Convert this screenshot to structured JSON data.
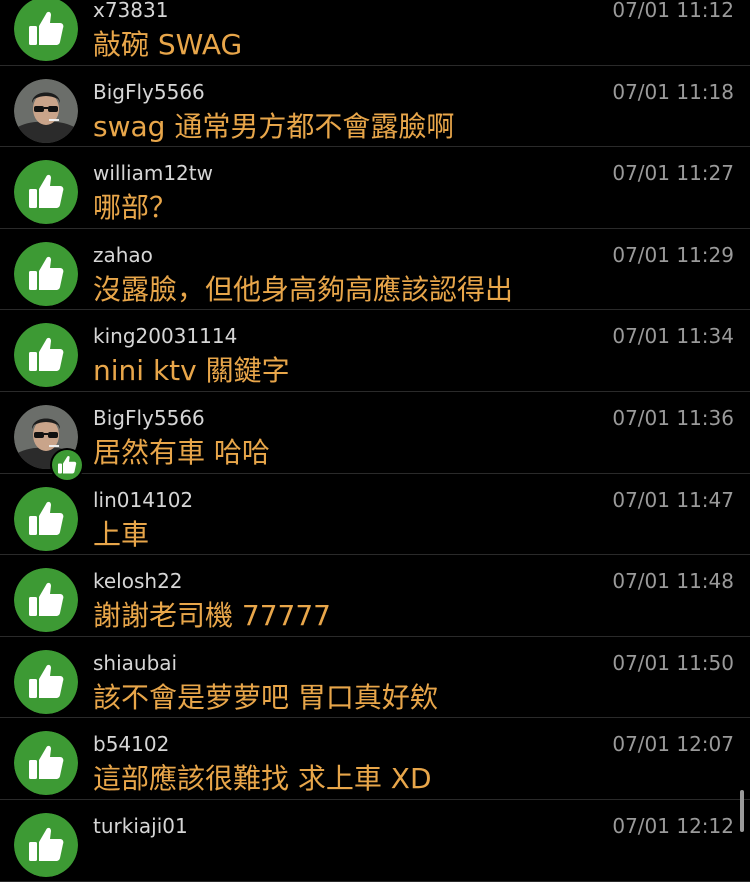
{
  "colors": {
    "background": "#000000",
    "username": "#d6d6d6",
    "timestamp": "#9a9a9a",
    "message": "#e8a64a",
    "like_avatar": "#3d9a34"
  },
  "comments": [
    {
      "username": "x73831",
      "time": "07/01 11:12",
      "text": "敲碗 SWAG",
      "avatar": "thumbs-up-icon"
    },
    {
      "username": "BigFly5566",
      "time": "07/01 11:18",
      "text": "swag 通常男方都不會露臉啊",
      "avatar": "user-photo"
    },
    {
      "username": "william12tw",
      "time": "07/01 11:27",
      "text": "哪部？",
      "avatar": "thumbs-up-icon"
    },
    {
      "username": "zahao",
      "time": "07/01 11:29",
      "text": "沒露臉，但他身高夠高應該認得出",
      "avatar": "thumbs-up-icon"
    },
    {
      "username": "king20031114",
      "time": "07/01 11:34",
      "text": "nini ktv 關鍵字",
      "avatar": "thumbs-up-icon"
    },
    {
      "username": "BigFly5566",
      "time": "07/01 11:36",
      "text": "居然有車 哈哈",
      "avatar": "user-photo-liked"
    },
    {
      "username": "lin014102",
      "time": "07/01 11:47",
      "text": "上車",
      "avatar": "thumbs-up-icon"
    },
    {
      "username": "kelosh22",
      "time": "07/01 11:48",
      "text": "謝謝老司機 77777",
      "avatar": "thumbs-up-icon"
    },
    {
      "username": "shiaubai",
      "time": "07/01 11:50",
      "text": "該不會是萝萝吧 胃口真好欸",
      "avatar": "thumbs-up-icon"
    },
    {
      "username": "b54102",
      "time": "07/01 12:07",
      "text": "這部應該很難找 求上車 XD",
      "avatar": "thumbs-up-icon"
    },
    {
      "username": "turkiaji01",
      "time": "07/01 12:12",
      "text": "",
      "avatar": "thumbs-up-icon"
    }
  ]
}
